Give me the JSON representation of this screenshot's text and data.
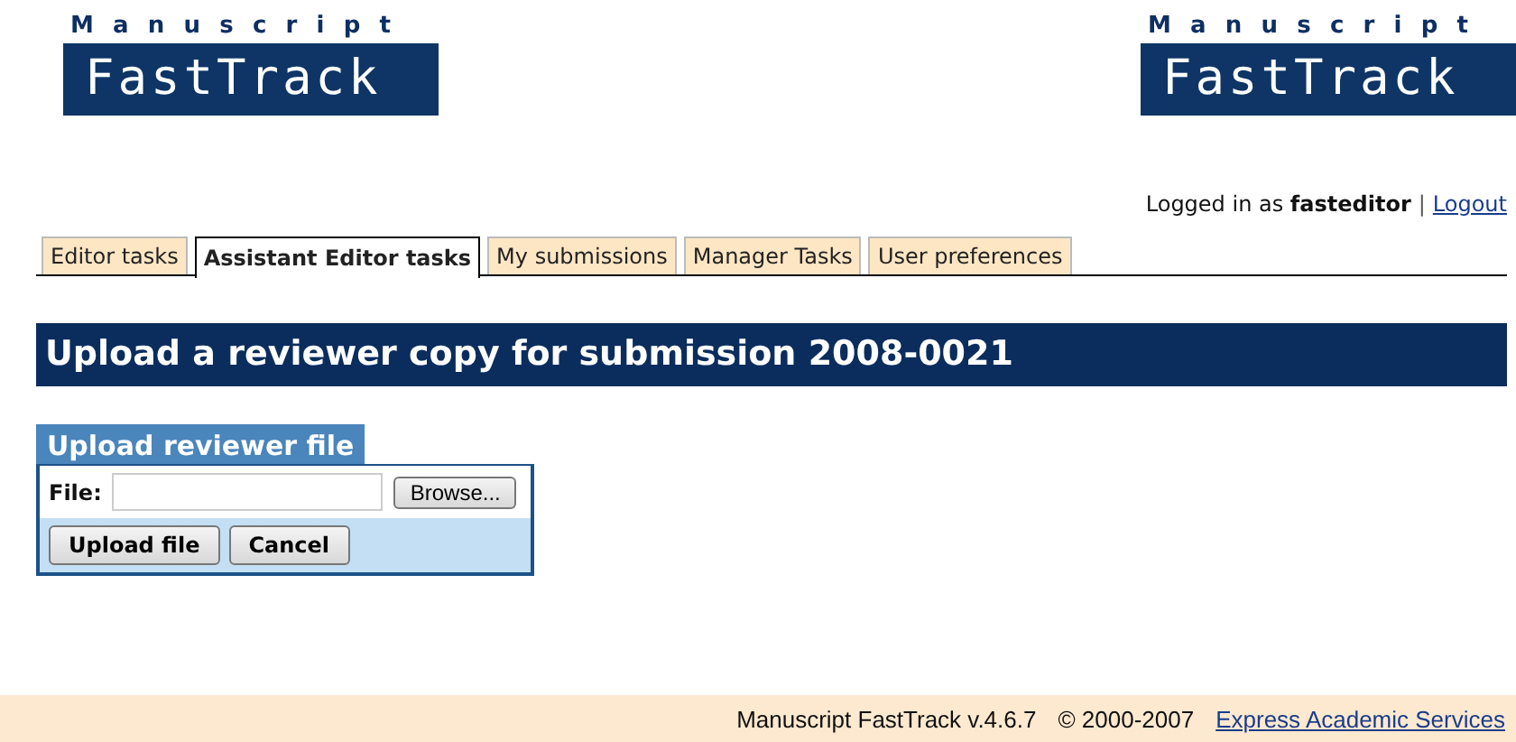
{
  "logos": [
    {
      "top": "Manuscript",
      "main": "FastTrack"
    },
    {
      "top": "Manuscript",
      "main": "FastTrack"
    }
  ],
  "user": {
    "prefix": "Logged in as",
    "name": "fasteditor",
    "separator": "|",
    "logout": "Logout"
  },
  "tabs": [
    {
      "label": "Editor tasks",
      "selected": false
    },
    {
      "label": "Assistant Editor tasks",
      "selected": true
    },
    {
      "label": "My submissions",
      "selected": false
    },
    {
      "label": "Manager Tasks",
      "selected": false
    },
    {
      "label": "User preferences",
      "selected": false
    }
  ],
  "page_title": "Upload a reviewer copy for submission 2008-0021",
  "panel": {
    "title": "Upload reviewer file",
    "field_label": "File:",
    "browse": "Browse...",
    "buttons": [
      "Upload file",
      "Cancel"
    ]
  },
  "footer": {
    "version": "Manuscript FastTrack v.4.6.7",
    "copyright": "© 2000-2007",
    "link": "Express Academic Services"
  }
}
